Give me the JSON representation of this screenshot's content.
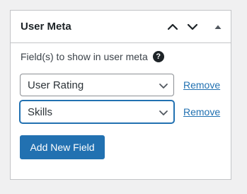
{
  "panel": {
    "title": "User Meta",
    "controls": {
      "move_up_icon": "chevron-up-icon",
      "move_down_icon": "chevron-down-icon",
      "toggle_icon": "triangle-up-icon"
    }
  },
  "content": {
    "help_text": "Field(s) to show in user meta",
    "help_icon": "question-icon",
    "help_icon_glyph": "?",
    "fields": [
      {
        "selected": "User Rating",
        "remove_label": "Remove"
      },
      {
        "selected": "Skills",
        "remove_label": "Remove"
      }
    ],
    "add_button_label": "Add New Field"
  },
  "colors": {
    "accent": "#2271b1",
    "background": "#f0f0f1",
    "panel_border": "#c3c4c7",
    "text": "#1d2327"
  }
}
